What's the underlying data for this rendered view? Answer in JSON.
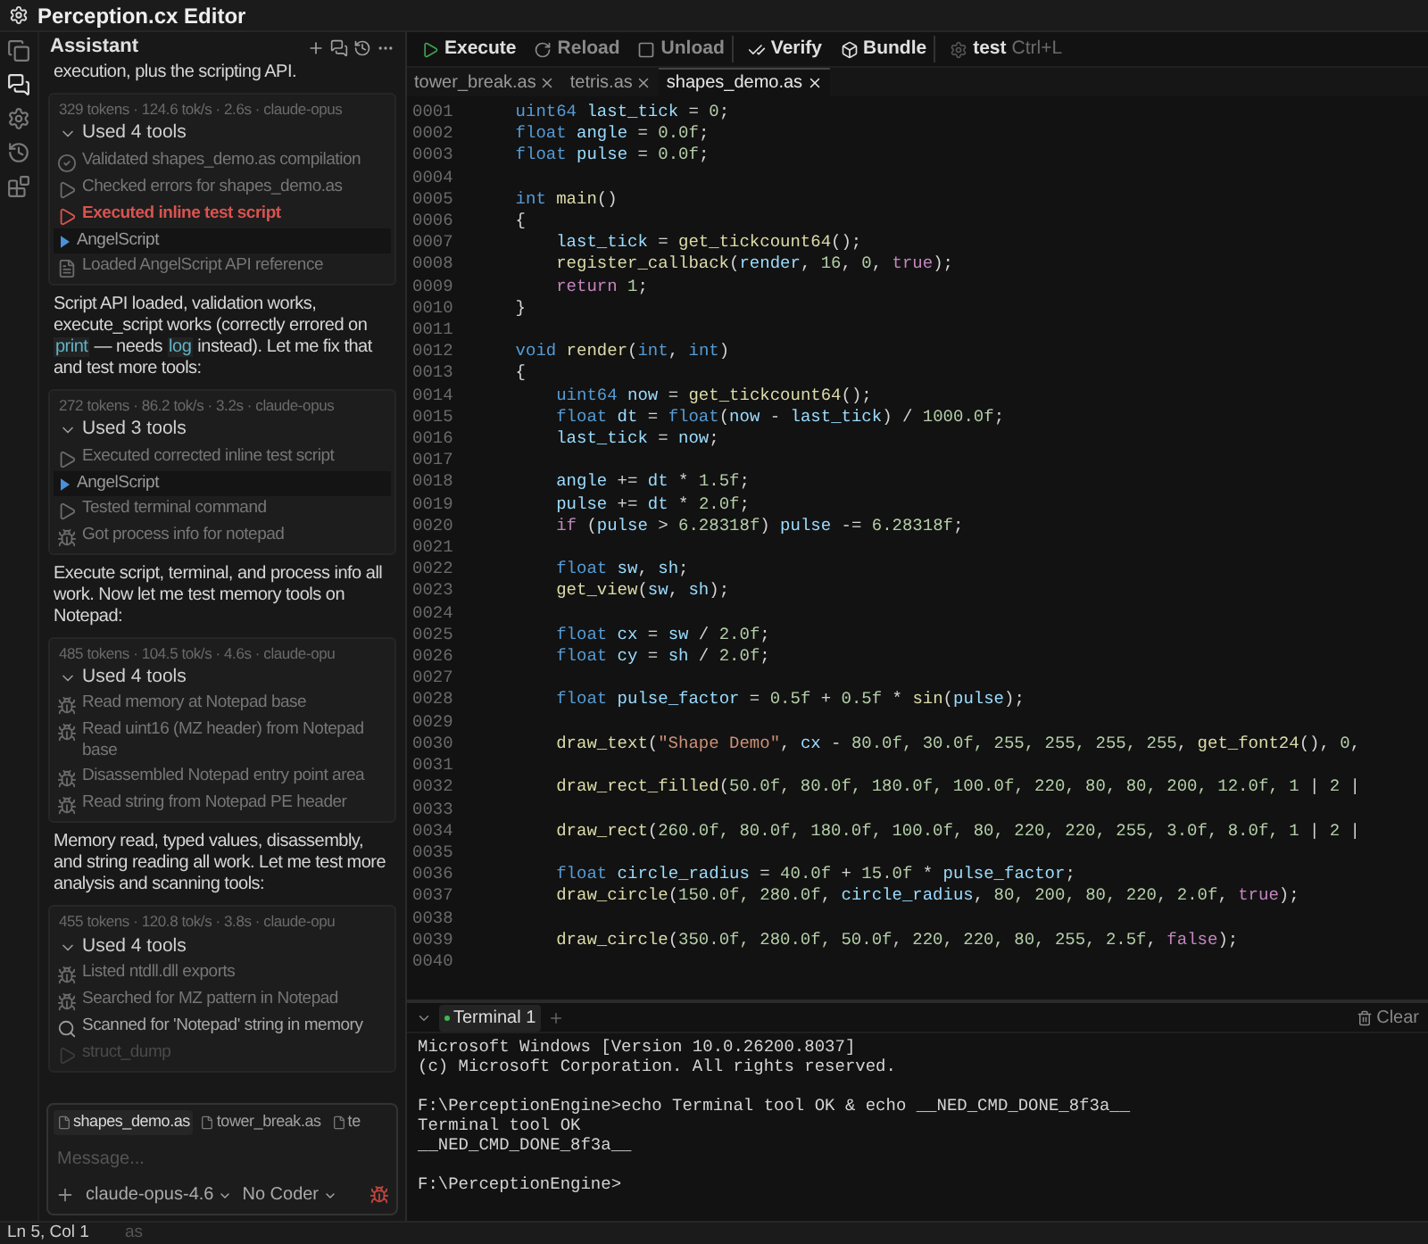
{
  "window": {
    "title": "Perception.cx Editor"
  },
  "activity_bar": {
    "items": [
      {
        "kind": "files",
        "selected": false
      },
      {
        "kind": "chat",
        "selected": true
      },
      {
        "kind": "settings",
        "selected": false
      },
      {
        "kind": "history",
        "selected": false
      },
      {
        "kind": "extensions",
        "selected": false
      }
    ]
  },
  "assistant": {
    "title": "Assistant",
    "items": [
      {
        "kind": "text",
        "segments": [
          {
            "kind": "text",
            "text": "execution, plus the scripting API."
          }
        ]
      },
      {
        "kind": "tools",
        "stats": "329 tokens · 124.6 tok/s · 2.6s · claude-opus",
        "summary": "Used 4 tools",
        "expanded": true,
        "tools": [
          {
            "kind": "check",
            "text": "Validated shapes_demo.as compilation"
          },
          {
            "kind": "run",
            "text": "Checked errors for shapes_demo.as"
          },
          {
            "kind": "error",
            "text": "Executed inline test script"
          },
          {
            "kind": "script",
            "text": "AngelScript"
          },
          {
            "kind": "doc",
            "text": "Loaded AngelScript API reference"
          }
        ]
      },
      {
        "kind": "text",
        "segments": [
          {
            "kind": "text",
            "text": "Script API loaded, validation works, execute_script works (correctly errored on "
          },
          {
            "kind": "code",
            "text": "print"
          },
          {
            "kind": "text",
            "text": " — needs "
          },
          {
            "kind": "code",
            "text": "log"
          },
          {
            "kind": "text",
            "text": " instead). Let me fix that and test more tools:"
          }
        ]
      },
      {
        "kind": "tools",
        "stats": "272 tokens · 86.2 tok/s · 3.2s · claude-opus",
        "summary": "Used 3 tools",
        "expanded": true,
        "tools": [
          {
            "kind": "run",
            "text": "Executed corrected inline test script"
          },
          {
            "kind": "script",
            "text": "AngelScript"
          },
          {
            "kind": "run",
            "text": "Tested terminal command"
          },
          {
            "kind": "gear",
            "text": "Got process info for notepad"
          }
        ]
      },
      {
        "kind": "text",
        "segments": [
          {
            "kind": "text",
            "text": "Execute script, terminal, and process info all work. Now let me test memory tools on Notepad:"
          }
        ]
      },
      {
        "kind": "tools",
        "stats": "485 tokens · 104.5 tok/s · 4.6s · claude-opu",
        "summary": "Used 4 tools",
        "expanded": true,
        "tools": [
          {
            "kind": "gear",
            "text": "Read memory at Notepad base"
          },
          {
            "kind": "gear",
            "text": "Read uint16 (MZ header) from Notepad base"
          },
          {
            "kind": "gear",
            "text": "Disassembled Notepad entry point area"
          },
          {
            "kind": "gear",
            "text": "Read string from Notepad PE header"
          }
        ]
      },
      {
        "kind": "text",
        "segments": [
          {
            "kind": "text",
            "text": "Memory read, typed values, disassembly, and string reading all work. Let me test more analysis and scanning tools:"
          }
        ]
      },
      {
        "kind": "tools",
        "stats": "455 tokens · 120.8 tok/s · 3.8s · claude-opu",
        "summary": "Used 4 tools",
        "expanded": true,
        "tools": [
          {
            "kind": "gear",
            "text": "Listed ntdll.dll exports"
          },
          {
            "kind": "gear",
            "text": "Searched for MZ pattern in Notepad"
          },
          {
            "kind": "search",
            "text": "Scanned for 'Notepad' string in memory"
          },
          {
            "kind": "pending",
            "text": "struct_dump"
          }
        ]
      }
    ],
    "composer": {
      "attachments": [
        {
          "name": "shapes_demo.as",
          "selected": true
        },
        {
          "name": "tower_break.as",
          "selected": false
        },
        {
          "name": "te",
          "selected": false
        }
      ],
      "placeholder": "Message...",
      "model": "claude-opus-4.6",
      "mode": "No Coder"
    }
  },
  "toolbar": {
    "groups": [
      [
        {
          "kind": "execute",
          "label": "Execute",
          "disabled": false
        },
        {
          "kind": "reload",
          "label": "Reload",
          "disabled": true
        },
        {
          "kind": "unload",
          "label": "Unload",
          "disabled": true
        }
      ],
      [
        {
          "kind": "verify",
          "label": "Verify",
          "disabled": false
        },
        {
          "kind": "bundle",
          "label": "Bundle",
          "disabled": false
        }
      ],
      [
        {
          "kind": "test",
          "label": "test",
          "shortcut": "Ctrl+L",
          "disabled": false
        }
      ]
    ]
  },
  "editor": {
    "tabs": [
      {
        "label": "tower_break.as",
        "selected": false
      },
      {
        "label": "tetris.as",
        "selected": false
      },
      {
        "label": "shapes_demo.as",
        "selected": true
      }
    ],
    "lines": [
      {
        "n": "0001",
        "kind": "top",
        "seg": [
          {
            "kind": "type",
            "text": "uint64"
          },
          {
            "kind": "var",
            "text": " last_tick"
          },
          {
            "kind": "p",
            "text": " = "
          },
          {
            "kind": "num",
            "text": "0"
          },
          {
            "kind": "p",
            "text": ";"
          }
        ]
      },
      {
        "n": "0002",
        "kind": "top",
        "seg": [
          {
            "kind": "type",
            "text": "float"
          },
          {
            "kind": "var",
            "text": " angle"
          },
          {
            "kind": "p",
            "text": " = "
          },
          {
            "kind": "num",
            "text": "0.0f"
          },
          {
            "kind": "p",
            "text": ";"
          }
        ]
      },
      {
        "n": "0003",
        "kind": "top",
        "seg": [
          {
            "kind": "type",
            "text": "float"
          },
          {
            "kind": "var",
            "text": " pulse"
          },
          {
            "kind": "p",
            "text": " = "
          },
          {
            "kind": "num",
            "text": "0.0f"
          },
          {
            "kind": "p",
            "text": ";"
          }
        ]
      },
      {
        "n": "0004",
        "kind": "blank"
      },
      {
        "n": "0005",
        "kind": "top",
        "seg": [
          {
            "kind": "type",
            "text": "int"
          },
          {
            "kind": "fn",
            "text": " main"
          },
          {
            "kind": "p",
            "text": "()"
          }
        ]
      },
      {
        "n": "0006",
        "kind": "top",
        "seg": [
          {
            "kind": "p",
            "text": "{"
          }
        ]
      },
      {
        "n": "0007",
        "kind": "body",
        "seg": [
          {
            "kind": "var",
            "text": "last_tick"
          },
          {
            "kind": "p",
            "text": " = "
          },
          {
            "kind": "fn",
            "text": "get_tickcount64"
          },
          {
            "kind": "p",
            "text": "();"
          }
        ]
      },
      {
        "n": "0008",
        "kind": "body",
        "seg": [
          {
            "kind": "fn",
            "text": "register_callback"
          },
          {
            "kind": "p",
            "text": "("
          },
          {
            "kind": "var",
            "text": "render"
          },
          {
            "kind": "p",
            "text": ", "
          },
          {
            "kind": "num",
            "text": "16"
          },
          {
            "kind": "p",
            "text": ", "
          },
          {
            "kind": "num",
            "text": "0"
          },
          {
            "kind": "p",
            "text": ", "
          },
          {
            "kind": "kw",
            "text": "true"
          },
          {
            "kind": "p",
            "text": ");"
          }
        ]
      },
      {
        "n": "0009",
        "kind": "body",
        "seg": [
          {
            "kind": "kw",
            "text": "return"
          },
          {
            "kind": "num",
            "text": " 1"
          },
          {
            "kind": "p",
            "text": ";"
          }
        ]
      },
      {
        "n": "0010",
        "kind": "top",
        "seg": [
          {
            "kind": "p",
            "text": "}"
          }
        ]
      },
      {
        "n": "0011",
        "kind": "blank"
      },
      {
        "n": "0012",
        "kind": "top",
        "seg": [
          {
            "kind": "type",
            "text": "void"
          },
          {
            "kind": "fn",
            "text": " render"
          },
          {
            "kind": "p",
            "text": "("
          },
          {
            "kind": "type",
            "text": "int"
          },
          {
            "kind": "p",
            "text": ", "
          },
          {
            "kind": "type",
            "text": "int"
          },
          {
            "kind": "p",
            "text": ")"
          }
        ]
      },
      {
        "n": "0013",
        "kind": "top",
        "seg": [
          {
            "kind": "p",
            "text": "{"
          }
        ]
      },
      {
        "n": "0014",
        "kind": "body",
        "seg": [
          {
            "kind": "type",
            "text": "uint64"
          },
          {
            "kind": "var",
            "text": " now"
          },
          {
            "kind": "p",
            "text": " = "
          },
          {
            "kind": "fn",
            "text": "get_tickcount64"
          },
          {
            "kind": "p",
            "text": "();"
          }
        ]
      },
      {
        "n": "0015",
        "kind": "body",
        "seg": [
          {
            "kind": "type",
            "text": "float"
          },
          {
            "kind": "var",
            "text": " dt"
          },
          {
            "kind": "p",
            "text": " = "
          },
          {
            "kind": "type",
            "text": "float"
          },
          {
            "kind": "p",
            "text": "("
          },
          {
            "kind": "var",
            "text": "now"
          },
          {
            "kind": "p",
            "text": " - "
          },
          {
            "kind": "var",
            "text": "last_tick"
          },
          {
            "kind": "p",
            "text": ") / "
          },
          {
            "kind": "num",
            "text": "1000.0f"
          },
          {
            "kind": "p",
            "text": ";"
          }
        ]
      },
      {
        "n": "0016",
        "kind": "body",
        "seg": [
          {
            "kind": "var",
            "text": "last_tick"
          },
          {
            "kind": "p",
            "text": " = "
          },
          {
            "kind": "var",
            "text": "now"
          },
          {
            "kind": "p",
            "text": ";"
          }
        ]
      },
      {
        "n": "0017",
        "kind": "blank"
      },
      {
        "n": "0018",
        "kind": "body",
        "seg": [
          {
            "kind": "var",
            "text": "angle"
          },
          {
            "kind": "p",
            "text": " += "
          },
          {
            "kind": "var",
            "text": "dt"
          },
          {
            "kind": "p",
            "text": " * "
          },
          {
            "kind": "num",
            "text": "1.5f"
          },
          {
            "kind": "p",
            "text": ";"
          }
        ]
      },
      {
        "n": "0019",
        "kind": "body",
        "seg": [
          {
            "kind": "var",
            "text": "pulse"
          },
          {
            "kind": "p",
            "text": " += "
          },
          {
            "kind": "var",
            "text": "dt"
          },
          {
            "kind": "p",
            "text": " * "
          },
          {
            "kind": "num",
            "text": "2.0f"
          },
          {
            "kind": "p",
            "text": ";"
          }
        ]
      },
      {
        "n": "0020",
        "kind": "body",
        "seg": [
          {
            "kind": "kw",
            "text": "if"
          },
          {
            "kind": "p",
            "text": " ("
          },
          {
            "kind": "var",
            "text": "pulse"
          },
          {
            "kind": "p",
            "text": " > "
          },
          {
            "kind": "num",
            "text": "6.28318f"
          },
          {
            "kind": "p",
            "text": ") "
          },
          {
            "kind": "var",
            "text": "pulse"
          },
          {
            "kind": "p",
            "text": " -= "
          },
          {
            "kind": "num",
            "text": "6.28318f"
          },
          {
            "kind": "p",
            "text": ";"
          }
        ]
      },
      {
        "n": "0021",
        "kind": "blank"
      },
      {
        "n": "0022",
        "kind": "body",
        "seg": [
          {
            "kind": "type",
            "text": "float"
          },
          {
            "kind": "var",
            "text": " sw"
          },
          {
            "kind": "p",
            "text": ", "
          },
          {
            "kind": "var",
            "text": "sh"
          },
          {
            "kind": "p",
            "text": ";"
          }
        ]
      },
      {
        "n": "0023",
        "kind": "body",
        "seg": [
          {
            "kind": "fn",
            "text": "get_view"
          },
          {
            "kind": "p",
            "text": "("
          },
          {
            "kind": "var",
            "text": "sw"
          },
          {
            "kind": "p",
            "text": ", "
          },
          {
            "kind": "var",
            "text": "sh"
          },
          {
            "kind": "p",
            "text": ");"
          }
        ]
      },
      {
        "n": "0024",
        "kind": "blank"
      },
      {
        "n": "0025",
        "kind": "body",
        "seg": [
          {
            "kind": "type",
            "text": "float"
          },
          {
            "kind": "var",
            "text": " cx"
          },
          {
            "kind": "p",
            "text": " = "
          },
          {
            "kind": "var",
            "text": "sw"
          },
          {
            "kind": "p",
            "text": " / "
          },
          {
            "kind": "num",
            "text": "2.0f"
          },
          {
            "kind": "p",
            "text": ";"
          }
        ]
      },
      {
        "n": "0026",
        "kind": "body",
        "seg": [
          {
            "kind": "type",
            "text": "float"
          },
          {
            "kind": "var",
            "text": " cy"
          },
          {
            "kind": "p",
            "text": " = "
          },
          {
            "kind": "var",
            "text": "sh"
          },
          {
            "kind": "p",
            "text": " / "
          },
          {
            "kind": "num",
            "text": "2.0f"
          },
          {
            "kind": "p",
            "text": ";"
          }
        ]
      },
      {
        "n": "0027",
        "kind": "blank"
      },
      {
        "n": "0028",
        "kind": "body",
        "seg": [
          {
            "kind": "type",
            "text": "float"
          },
          {
            "kind": "var",
            "text": " pulse_factor"
          },
          {
            "kind": "p",
            "text": " = "
          },
          {
            "kind": "num",
            "text": "0.5f"
          },
          {
            "kind": "p",
            "text": " + "
          },
          {
            "kind": "num",
            "text": "0.5f"
          },
          {
            "kind": "p",
            "text": " * "
          },
          {
            "kind": "fn",
            "text": "sin"
          },
          {
            "kind": "p",
            "text": "("
          },
          {
            "kind": "var",
            "text": "pulse"
          },
          {
            "kind": "p",
            "text": ");"
          }
        ]
      },
      {
        "n": "0029",
        "kind": "blank"
      },
      {
        "n": "0030",
        "kind": "body",
        "seg": [
          {
            "kind": "fn",
            "text": "draw_text"
          },
          {
            "kind": "p",
            "text": "("
          },
          {
            "kind": "str",
            "text": "\"Shape Demo\""
          },
          {
            "kind": "p",
            "text": ", "
          },
          {
            "kind": "var",
            "text": "cx"
          },
          {
            "kind": "p",
            "text": " - "
          },
          {
            "kind": "num",
            "text": "80.0f, 30.0f, 255, 255, 255, 255"
          },
          {
            "kind": "p",
            "text": ", "
          },
          {
            "kind": "fn",
            "text": "get_font24"
          },
          {
            "kind": "p",
            "text": "(), "
          },
          {
            "kind": "num",
            "text": "0"
          },
          {
            "kind": "p",
            "text": ","
          }
        ]
      },
      {
        "n": "0031",
        "kind": "blank"
      },
      {
        "n": "0032",
        "kind": "body",
        "seg": [
          {
            "kind": "fn",
            "text": "draw_rect_filled"
          },
          {
            "kind": "p",
            "text": "("
          },
          {
            "kind": "num",
            "text": "50.0f, 80.0f, 180.0f, 100.0f, 220, 80, 80, 200, 12.0f, 1"
          },
          {
            "kind": "p",
            "text": " | "
          },
          {
            "kind": "num",
            "text": "2"
          },
          {
            "kind": "p",
            "text": " |"
          }
        ]
      },
      {
        "n": "0033",
        "kind": "blank"
      },
      {
        "n": "0034",
        "kind": "body",
        "seg": [
          {
            "kind": "fn",
            "text": "draw_rect"
          },
          {
            "kind": "p",
            "text": "("
          },
          {
            "kind": "num",
            "text": "260.0f, 80.0f, 180.0f, 100.0f, 80, 220, 220, 255, 3.0f, 8.0f, 1"
          },
          {
            "kind": "p",
            "text": " | "
          },
          {
            "kind": "num",
            "text": "2"
          },
          {
            "kind": "p",
            "text": " |"
          }
        ]
      },
      {
        "n": "0035",
        "kind": "blank"
      },
      {
        "n": "0036",
        "kind": "body",
        "seg": [
          {
            "kind": "type",
            "text": "float"
          },
          {
            "kind": "var",
            "text": " circle_radius"
          },
          {
            "kind": "p",
            "text": " = "
          },
          {
            "kind": "num",
            "text": "40.0f"
          },
          {
            "kind": "p",
            "text": " + "
          },
          {
            "kind": "num",
            "text": "15.0f"
          },
          {
            "kind": "p",
            "text": " * "
          },
          {
            "kind": "var",
            "text": "pulse_factor"
          },
          {
            "kind": "p",
            "text": ";"
          }
        ]
      },
      {
        "n": "0037",
        "kind": "body",
        "seg": [
          {
            "kind": "fn",
            "text": "draw_circle"
          },
          {
            "kind": "p",
            "text": "("
          },
          {
            "kind": "num",
            "text": "150.0f, 280.0f"
          },
          {
            "kind": "p",
            "text": ", "
          },
          {
            "kind": "var",
            "text": "circle_radius"
          },
          {
            "kind": "p",
            "text": ", "
          },
          {
            "kind": "num",
            "text": "80, 200, 80, 220, 2.0f"
          },
          {
            "kind": "p",
            "text": ", "
          },
          {
            "kind": "kw",
            "text": "true"
          },
          {
            "kind": "p",
            "text": ");"
          }
        ]
      },
      {
        "n": "0038",
        "kind": "blank"
      },
      {
        "n": "0039",
        "kind": "body",
        "seg": [
          {
            "kind": "fn",
            "text": "draw_circle"
          },
          {
            "kind": "p",
            "text": "("
          },
          {
            "kind": "num",
            "text": "350.0f, 280.0f, 50.0f, 220, 220, 80, 255, 2.5f"
          },
          {
            "kind": "p",
            "text": ", "
          },
          {
            "kind": "kw",
            "text": "false"
          },
          {
            "kind": "p",
            "text": ");"
          }
        ]
      },
      {
        "n": "0040",
        "kind": "blank"
      }
    ]
  },
  "terminal": {
    "tabs": [
      {
        "label": "Terminal 1",
        "selected": true
      }
    ],
    "clear": "Clear",
    "blocks": [
      [
        "Microsoft Windows [Version 10.0.26200.8037]",
        "(c) Microsoft Corporation. All rights reserved."
      ],
      [
        "F:\\PerceptionEngine>echo Terminal tool OK & echo __NED_CMD_DONE_8f3a__",
        "Terminal tool OK",
        "__NED_CMD_DONE_8f3a__"
      ],
      [
        "F:\\PerceptionEngine>"
      ]
    ]
  },
  "status_bar": {
    "position": "Ln 5, Col 1",
    "language": "as"
  }
}
